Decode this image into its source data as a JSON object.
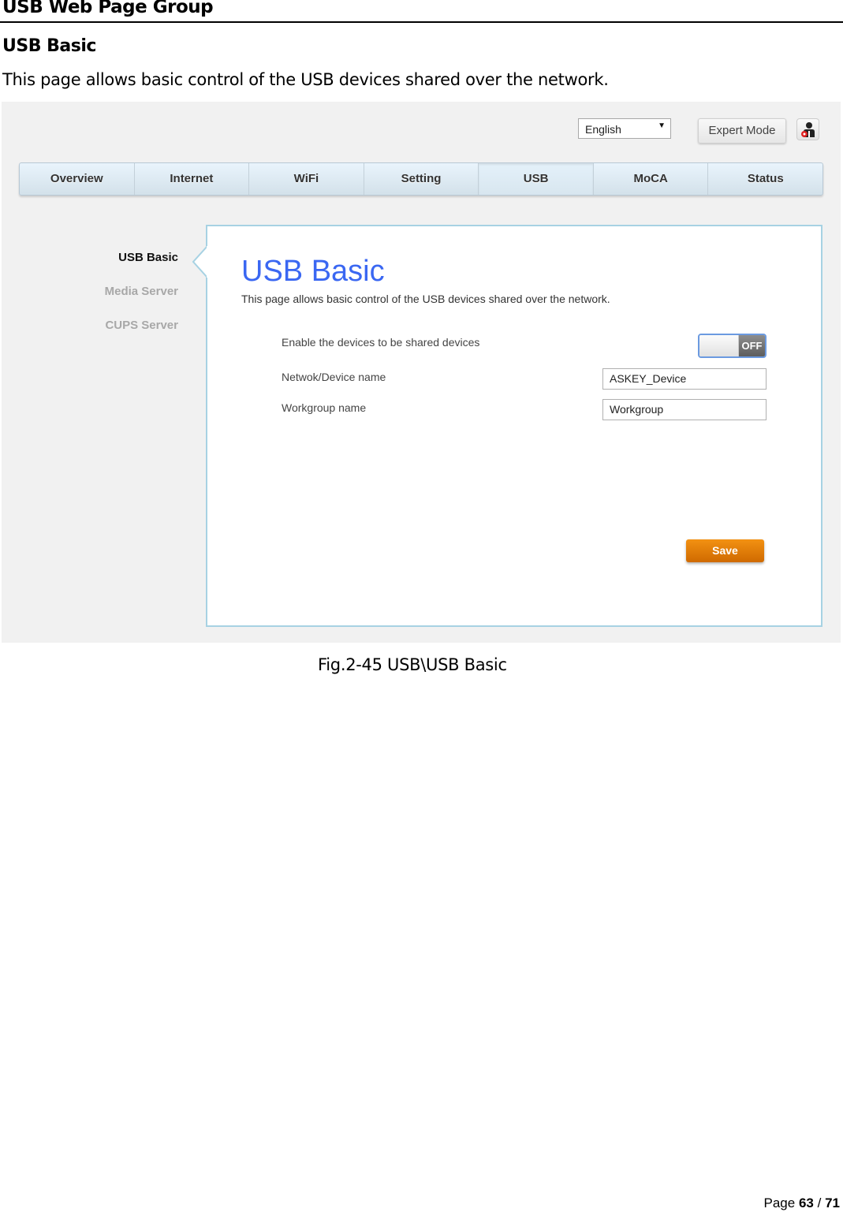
{
  "document": {
    "heading": "USB Web Page Group",
    "subheading": "USB Basic",
    "intro": "This page allows basic control of the USB devices shared over the network.",
    "caption": "Fig.2-45 USB\\USB Basic",
    "page": {
      "prefix": "Page",
      "current": "63",
      "separator": "/",
      "total": "71"
    }
  },
  "screenshot": {
    "header": {
      "language_selected": "English",
      "language_arrow": "▼",
      "expert_mode_label": "Expert Mode",
      "user_icon": "user-logout-icon"
    },
    "nav": {
      "items": [
        {
          "label": "Overview"
        },
        {
          "label": "Internet"
        },
        {
          "label": "WiFi"
        },
        {
          "label": "Setting"
        },
        {
          "label": "USB",
          "active": true
        },
        {
          "label": "MoCA"
        },
        {
          "label": "Status"
        }
      ]
    },
    "sidebar": {
      "items": [
        {
          "label": "USB Basic",
          "active": true
        },
        {
          "label": "Media Server"
        },
        {
          "label": "CUPS Server"
        }
      ]
    },
    "panel": {
      "title": "USB Basic",
      "description": "This page allows basic control of the USB devices shared over the network.",
      "enable_label": "Enable the devices to be shared devices",
      "enable_state": "OFF",
      "device_name_label": "Netwok/Device name",
      "device_name_value": "ASKEY_Device",
      "workgroup_label": "Workgroup name",
      "workgroup_value": "Workgroup",
      "save_label": "Save"
    },
    "colors": {
      "title_blue": "#3a67f2",
      "save_orange": "#e47e09",
      "panel_border": "#a7d2e3"
    }
  }
}
